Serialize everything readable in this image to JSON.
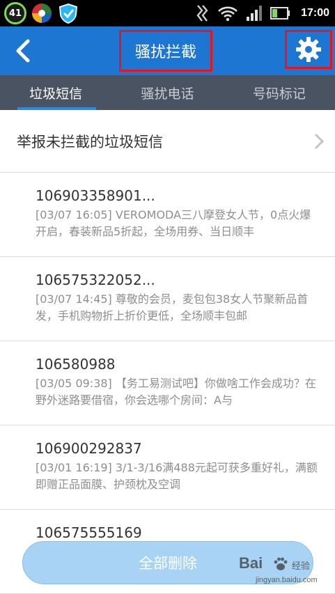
{
  "status_bar": {
    "badge_text": "41",
    "time": "17:00",
    "icons": [
      "android-badge-icon",
      "app-colorful-icon",
      "shield-icon",
      "notification-icon",
      "wifi-icon",
      "signal-icon",
      "battery-icon"
    ],
    "battery_level": 0.35,
    "battery_color": "#7ed957"
  },
  "header": {
    "title": "骚扰拦截",
    "back_icon": "back-arrow-icon",
    "settings_icon": "gear-icon",
    "background": "#1d76d2",
    "highlight_color": "#e8141b"
  },
  "tabs": [
    {
      "label": "垃圾短信",
      "active": true
    },
    {
      "label": "骚扰电话",
      "active": false
    },
    {
      "label": "号码标记",
      "active": false
    }
  ],
  "report": {
    "label": "举报未拦截的垃圾短信"
  },
  "messages": [
    {
      "number": "106903358901...",
      "body": "[03/07 16:05]  VEROMODA三八摩登女人节，0点火爆开启，春装新品5折起，全场用券、当日顺丰"
    },
    {
      "number": "106575322052...",
      "body": "[03/07 14:45]  尊敬的会员，麦包包38女人节聚新品首发，手机购物折上折价更低，全场顺丰包邮"
    },
    {
      "number": "106580988",
      "body": "[03/05 09:38]  【务工易测试吧】你做啥工作会成功？在野外迷路要借宿，你会选哪个房间：A与"
    },
    {
      "number": "106900292837",
      "body": "[03/01 16:19]  3/1-3/16满488元起可获多重好礼，满额即赠正品面膜、护颈枕及空调"
    },
    {
      "number": "106575555169",
      "body": ""
    }
  ],
  "footer": {
    "delete_all_label": "全部删除"
  },
  "watermark": {
    "brand": "Bai",
    "brand_tail": "经验",
    "url": "jingyan.baidu.com"
  }
}
